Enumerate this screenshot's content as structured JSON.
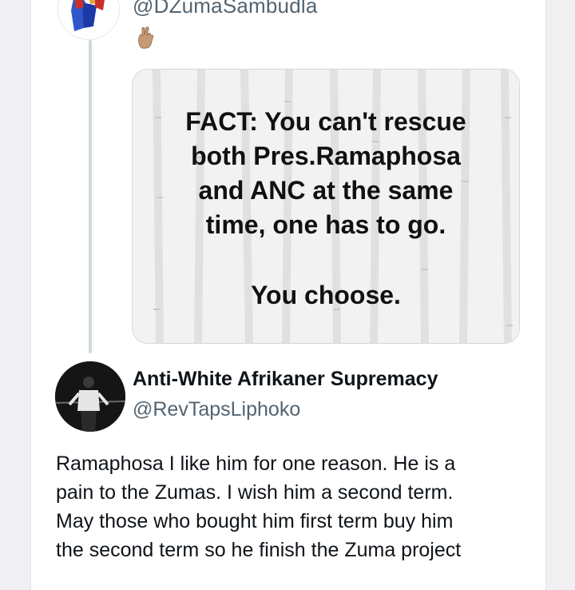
{
  "tweet_parent": {
    "handle": "@DZumaSambudla",
    "emoji": "🤞",
    "media": {
      "lines": [
        "FACT: You can't rescue",
        "both Pres.Ramaphosa",
        "and ANC at the same",
        "time, one has to go."
      ],
      "closing": "You choose."
    }
  },
  "tweet_reply": {
    "name": "Anti-White Afrikaner Supremacy",
    "handle": "@RevTapsLiphoko",
    "text_lines": [
      "Ramaphosa I like him for one reason. He is a",
      "pain to the Zumas. I wish him a second term.",
      "May those who bought him first term buy him",
      "the second term so he finish the Zuma project"
    ]
  },
  "colors": {
    "background": "#f0f0f2",
    "card": "#ffffff",
    "secondary_text": "#536471",
    "primary_text": "#0f1419",
    "thread_line": "#cfd9de"
  }
}
